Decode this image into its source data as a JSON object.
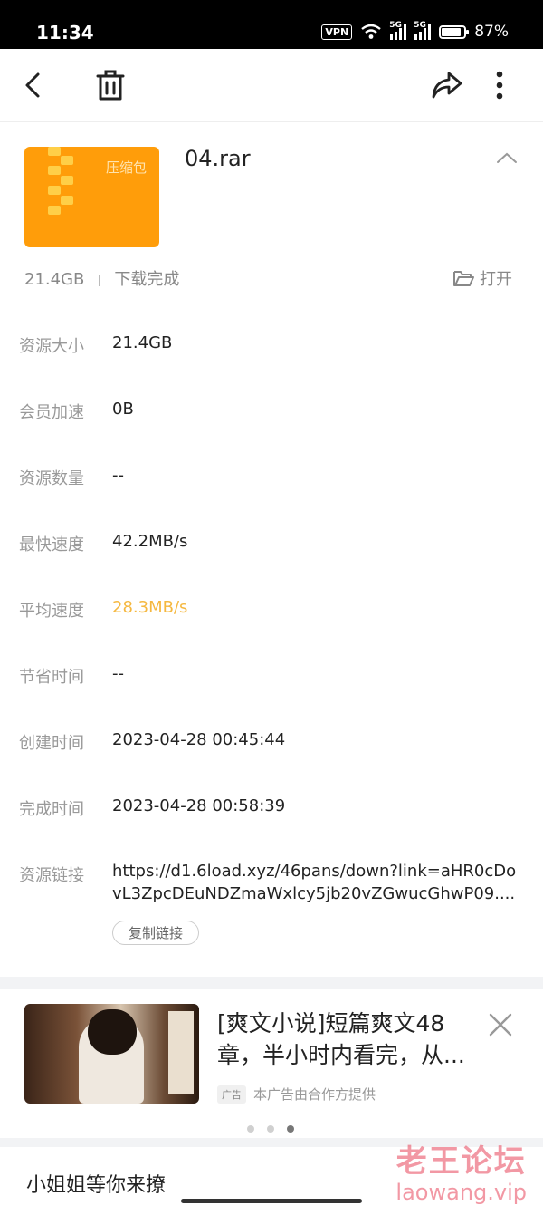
{
  "status_bar": {
    "time": "11:34",
    "vpn": "VPN",
    "net1": "5G",
    "net2": "5G",
    "battery_level": 0.87,
    "battery": "87%"
  },
  "toolbar": {
    "back_icon": "back-arrow-icon",
    "delete_icon": "trash-icon",
    "share_icon": "share-icon",
    "more_icon": "more-vertical-icon"
  },
  "file": {
    "thumb_label": "压缩包",
    "name": "04.rar",
    "size": "21.4GB",
    "status": "下载完成",
    "open_label": "打开"
  },
  "details": [
    {
      "label": "资源大小",
      "value": "21.4GB"
    },
    {
      "label": "会员加速",
      "value": "0B"
    },
    {
      "label": "资源数量",
      "value": "--"
    },
    {
      "label": "最快速度",
      "value": "42.2MB/s"
    },
    {
      "label": "平均速度",
      "value": "28.3MB/s"
    },
    {
      "label": "节省时间",
      "value": "--"
    },
    {
      "label": "创建时间",
      "value": "2023-04-28 00:45:44"
    },
    {
      "label": "完成时间",
      "value": "2023-04-28 00:58:39"
    }
  ],
  "link": {
    "label": "资源链接",
    "line1": "https://d1.6load.xyz/46pans/down?link=aHR0cDo",
    "line2": "vL3ZpcDEuNDZmaWxlcy5jb20vZGwucGhwP09....",
    "copy_label": "复制链接"
  },
  "ad": {
    "title": "[爽文小说]短篇爽文48章，半小时内看完，从...",
    "badge": "广告",
    "provider": "本广告由合作方提供",
    "page_count": 3,
    "active_page": 3
  },
  "bottom": {
    "text": "小姐姐等你来撩"
  },
  "watermark": {
    "cn": "老王论坛",
    "en": "laowang.vip"
  },
  "colors": {
    "accent": "#f5b840",
    "thumb": "#ff9d0a",
    "watermark": "#e8455a"
  }
}
